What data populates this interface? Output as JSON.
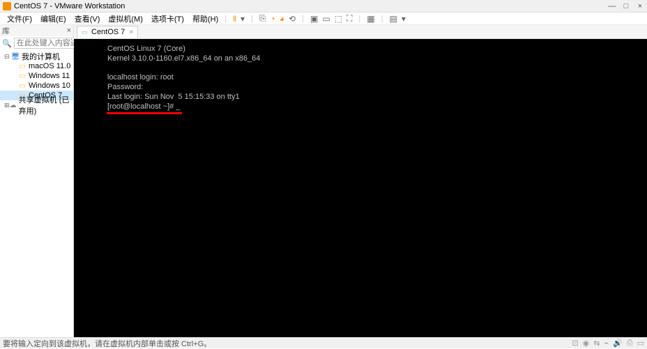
{
  "window": {
    "title": "CentOS 7 - VMware Workstation"
  },
  "menu": {
    "items": [
      "文件(F)",
      "编辑(E)",
      "查看(V)",
      "虚拟机(M)",
      "选项卡(T)",
      "帮助(H)"
    ]
  },
  "sidebar": {
    "header": "库",
    "close": "×",
    "search_placeholder": "在此处键入内容进行搜索",
    "tree": {
      "root": "我的计算机",
      "children": [
        "macOS 11.0",
        "Windows 11",
        "Windows 10",
        "CentOS 7"
      ],
      "shared": "共享虚拟机 (已弃用)"
    }
  },
  "tab": {
    "label": "CentOS 7"
  },
  "console": {
    "line1": "CentOS Linux 7 (Core)",
    "line2": "Kernel 3.10.0-1160.el7.x86_64 on an x86_64",
    "line3": "localhost login: root",
    "line4": "Password:",
    "line5": "Last login: Sun Nov  5 15:15:33 on tty1",
    "line6": "[root@localhost ~]# ",
    "cursor": "_"
  },
  "statusbar": {
    "text": "要将输入定向到该虚拟机，请在虚拟机内部单击或按 Ctrl+G。"
  }
}
